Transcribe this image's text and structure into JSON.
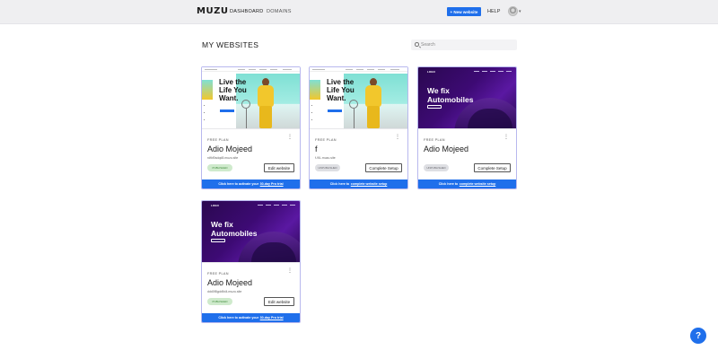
{
  "header": {
    "logo": "MUZU",
    "nav": [
      "DASHBOARD",
      "DOMAINS"
    ],
    "new_website_label": "+ New website",
    "help_label": "HELP"
  },
  "main": {
    "title": "MY WEBSITES",
    "search": {
      "placeholder": "Search",
      "value": ""
    }
  },
  "cards": [
    {
      "thumbnail_headline": "Live the Life You Want.",
      "plan": "FREE PLAN",
      "name": "Adio Mojeed",
      "url": "rdfkf0sdqd8.muzu.site",
      "status": "PUBLISHED",
      "action": "Edit website",
      "banner_text": "Click here to activate your",
      "banner_link": "30-day Pro trial"
    },
    {
      "thumbnail_headline": "Live the Life You Want.",
      "plan": "FREE PLAN",
      "name": "f",
      "url": "f-9lL.muzu.site",
      "status": "UNPUBLISHED",
      "action": "Complete Setup",
      "banner_text": "Click here to",
      "banner_link": "complete website setup"
    },
    {
      "thumbnail_headline": "We fix Automobiles",
      "plan": "FREE PLAN",
      "name": "Adio Mojeed",
      "url": "",
      "status": "UNPUBLISHED",
      "action": "Complete Setup",
      "banner_text": "Click here to",
      "banner_link": "complete website setup"
    },
    {
      "thumbnail_headline": "We fix Automobiles",
      "plan": "FREE PLAN",
      "name": "Adio Mojeed",
      "url": "ddd0f8gdd9d4.muzu.site",
      "status": "PUBLISHED",
      "action": "Edit website",
      "banner_text": "Click here to activate your",
      "banner_link": "30-day Pro trial"
    }
  ],
  "help_fab": "?"
}
